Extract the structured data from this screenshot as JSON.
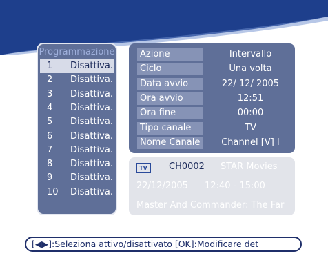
{
  "programs": {
    "title": "Programmazione",
    "rows": [
      {
        "num": "1",
        "status": "Disattiva."
      },
      {
        "num": "2",
        "status": "Disattiva."
      },
      {
        "num": "3",
        "status": "Disattiva."
      },
      {
        "num": "4",
        "status": "Disattiva."
      },
      {
        "num": "5",
        "status": "Disattiva."
      },
      {
        "num": "6",
        "status": "Disattiva."
      },
      {
        "num": "7",
        "status": "Disattiva."
      },
      {
        "num": "8",
        "status": "Disattiva."
      },
      {
        "num": "9",
        "status": "Disattiva."
      },
      {
        "num": "10",
        "status": "Disattiva."
      }
    ],
    "selected_index": 0
  },
  "details": {
    "rows": [
      {
        "label": "Azione",
        "value": "Intervallo"
      },
      {
        "label": "Ciclo",
        "value": "Una volta"
      },
      {
        "label": "Data avvio",
        "value": "22/ 12/ 2005"
      },
      {
        "label": "Ora avvio",
        "value": "12:51"
      },
      {
        "label": "Ora fine",
        "value": "00:00"
      },
      {
        "label": "Tipo canale",
        "value": "TV"
      },
      {
        "label": "Nome Canale",
        "value": "Channel [V] I"
      }
    ]
  },
  "info": {
    "icon_text": "TV",
    "channel": "CH0002",
    "channel_name": "STAR Movies",
    "date": "22/12/2005",
    "time": "12:40  -  15:00",
    "title": "Master And Commander: The Far"
  },
  "help": {
    "text": "[◀▶]:Seleziona attivo/disattivato  [OK]:Modificare det"
  },
  "colors": {
    "header_blue": "#1e3f8c",
    "panel": "#5f6f98",
    "label_bg": "#8693b6",
    "info_bg": "#e2e4ea"
  }
}
